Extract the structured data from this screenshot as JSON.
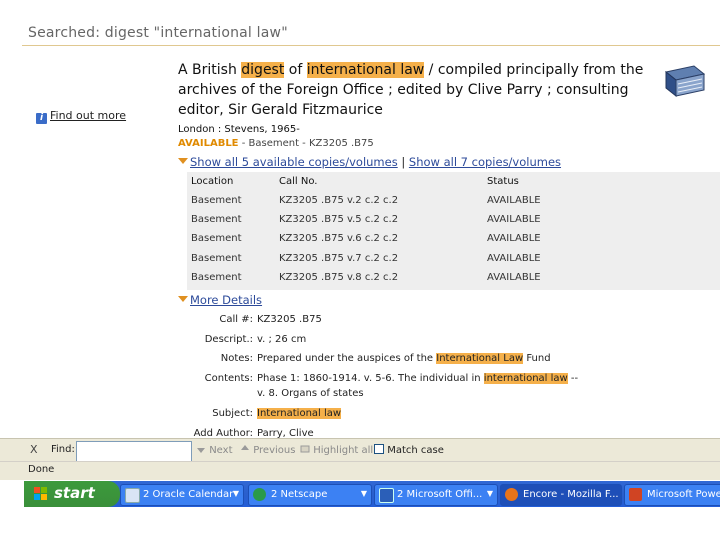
{
  "header": {
    "searched": "Searched: digest \"international law\""
  },
  "sidebar": {
    "find_out_more": "Find out more",
    "info_icon": "i"
  },
  "record": {
    "title_1": "A British ",
    "title_hl_1": "digest",
    "title_2": " of ",
    "title_hl_2": "international law",
    "title_3": " / compiled principally from the archives of the Foreign Office ; edited by Clive Parry ; consulting editor, Sir Gerald Fitzmaurice",
    "publication": "London : Stevens, 1965-",
    "availability_status": "AVAILABLE",
    "availability_rest": "  -  Basement  -  KZ3205 .B75",
    "show_available": "Show all 5 available copies/volumes",
    "separator": " | ",
    "show_all": "Show all 7 copies/volumes"
  },
  "copies": {
    "columns": [
      "Location",
      "Call No.",
      "Status"
    ],
    "rows": [
      [
        "Basement",
        "KZ3205 .B75 v.2 c.2 c.2",
        "AVAILABLE"
      ],
      [
        "Basement",
        "KZ3205 .B75 v.5 c.2 c.2",
        "AVAILABLE"
      ],
      [
        "Basement",
        "KZ3205 .B75 v.6 c.2 c.2",
        "AVAILABLE"
      ],
      [
        "Basement",
        "KZ3205 .B75 v.7 c.2 c.2",
        "AVAILABLE"
      ],
      [
        "Basement",
        "KZ3205 .B75 v.8 c.2 c.2",
        "AVAILABLE"
      ]
    ]
  },
  "details": {
    "toggle": "More Details",
    "call_label": "Call #:",
    "call_value": "KZ3205 .B75",
    "descript_label": "Descript.:",
    "descript_value": "v. ; 26 cm",
    "notes_label": "Notes:",
    "notes_pre": "Prepared under the auspices of the ",
    "notes_hl": "International Law",
    "notes_post": " Fund",
    "contents_label": "Contents:",
    "contents_pre": "Phase 1: 1860-1914. v. 5-6. The individual in ",
    "contents_hl": "international law",
    "contents_post": " --",
    "contents_line2": "v. 8. Organs of states",
    "subject_label": "Subject:",
    "subject_hl": "International law",
    "author_label": "Add Author:",
    "author_value": "Parry, Clive"
  },
  "findbar": {
    "close": "X",
    "label": "Find:",
    "value": "",
    "next": "Next",
    "previous": "Previous",
    "highlight": "Highlight all",
    "match_case": "Match case"
  },
  "status": {
    "text": "Done"
  },
  "taskbar": {
    "start": "start",
    "items": [
      {
        "label": "2 Oracle Calendar",
        "icon": "calendar-icon"
      },
      {
        "label": "2 Netscape",
        "icon": "netscape-icon"
      },
      {
        "label": "2 Microsoft Offi...",
        "icon": "word-icon"
      },
      {
        "label": "Encore - Mozilla F...",
        "icon": "firefox-icon"
      },
      {
        "label": "Microsoft PowerP...",
        "icon": "powerpoint-icon"
      }
    ]
  },
  "colors": {
    "highlight": "#f5b04a",
    "link": "#2c4a9a",
    "accent": "#e08a00",
    "taskbar": "#2a5fcc",
    "start": "#3a8f3a"
  }
}
